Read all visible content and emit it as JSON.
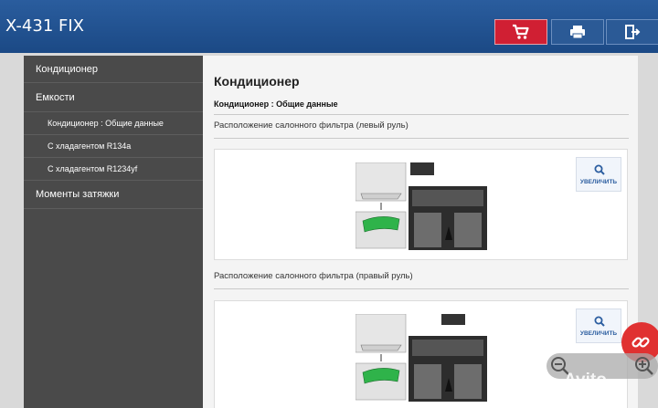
{
  "app": {
    "title": "X-431 FIX"
  },
  "toolbar": {
    "cart_icon": "shopping-cart-icon",
    "print_icon": "printer-icon",
    "exit_icon": "exit-icon",
    "accent": "#d01f33",
    "bar_color": "#1f4e8c"
  },
  "sidebar": {
    "items": [
      {
        "label": "Кондиционер"
      },
      {
        "label": "Емкости"
      },
      {
        "label": "Кондиционер : Общие данные"
      },
      {
        "label": "С хладагентом R134a"
      },
      {
        "label": "С хладагентом R1234yf"
      },
      {
        "label": "Моменты затяжки"
      }
    ]
  },
  "main": {
    "heading": "Кондиционер",
    "subheading": "Кондиционер : Общие данные",
    "sections": [
      {
        "caption": "Расположение салонного фильтра (левый руль)",
        "zoom_label": "УВЕЛИЧИТЬ"
      },
      {
        "caption": "Расположение салонного фильтра (правый руль)",
        "zoom_label": "УВЕЛИЧИТЬ"
      }
    ]
  },
  "overlay": {
    "link_icon": "link-icon",
    "zoom_out_icon": "zoom-out-icon",
    "zoom_in_icon": "zoom-in-icon",
    "watermark": "Avito"
  }
}
